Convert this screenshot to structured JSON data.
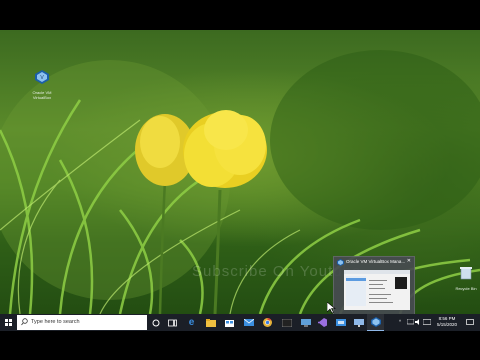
{
  "desktop": {
    "icons": [
      {
        "label": "Oracle VM VirtualBox",
        "icon": "virtualbox-icon"
      },
      {
        "label": "Recycle Bin",
        "icon": "recycle-bin-icon"
      }
    ],
    "watermark": "Subscribe On Youtube"
  },
  "task_preview": {
    "title": "Oracle VM VirtualBox Mana..."
  },
  "taskbar": {
    "search_placeholder": "Type here to search",
    "clock_time": "8:56 PM",
    "clock_date": "5/15/2020"
  }
}
